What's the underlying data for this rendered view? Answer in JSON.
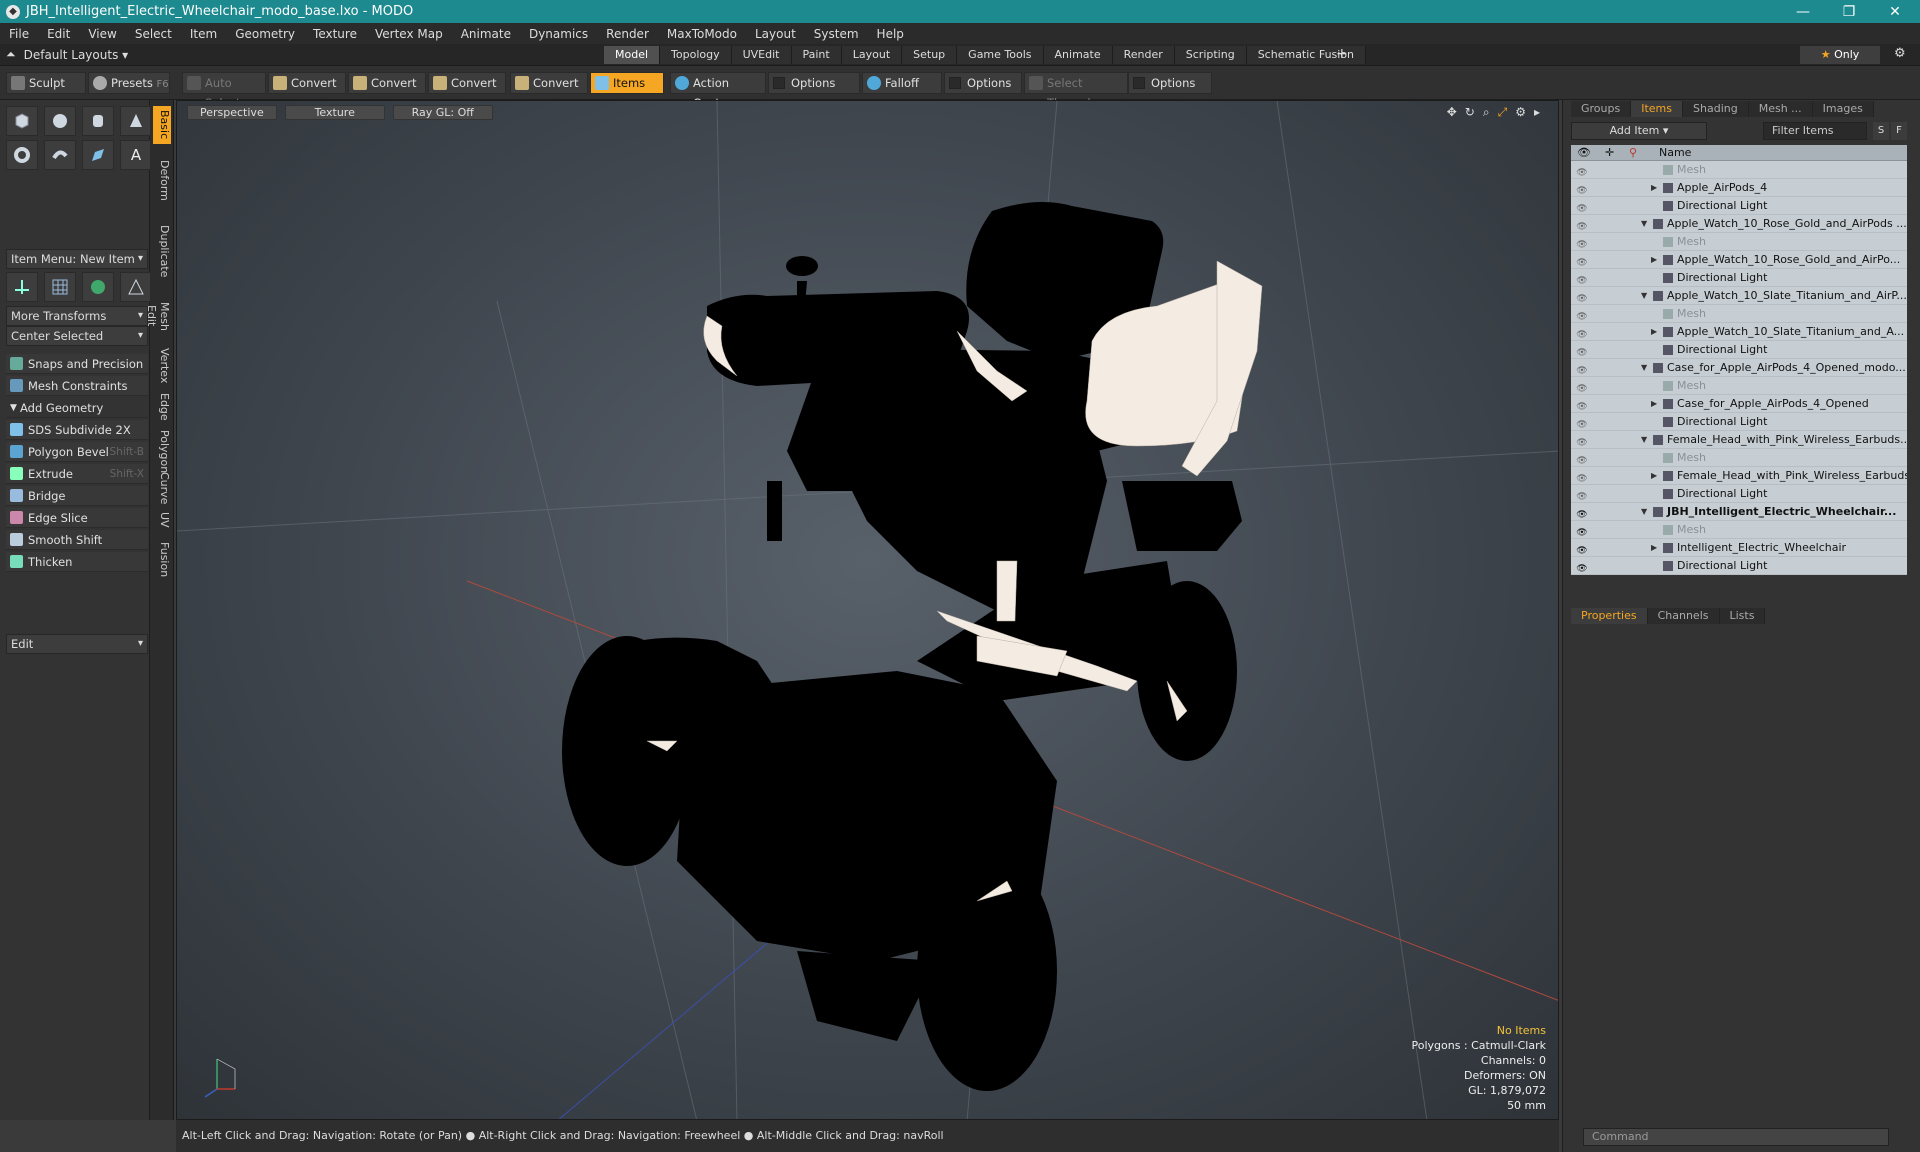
{
  "title": "JBH_Intelligent_Electric_Wheelchair_modo_base.lxo - MODO",
  "menu": [
    "File",
    "Edit",
    "View",
    "Select",
    "Item",
    "Geometry",
    "Texture",
    "Vertex Map",
    "Animate",
    "Dynamics",
    "Render",
    "MaxToModo",
    "Layout",
    "System",
    "Help"
  ],
  "layout_name": "Default Layouts",
  "tabs": [
    "Model",
    "Topology",
    "UVEdit",
    "Paint",
    "Layout",
    "Setup",
    "Game Tools",
    "Animate",
    "Render",
    "Scripting",
    "Schematic Fusion"
  ],
  "only_label": "Only",
  "toolbar": {
    "sculpt": "Sculpt",
    "presets": "Presets",
    "presets_key": "F6",
    "auto_select": "Auto Select",
    "convert": "Convert",
    "items": "Items",
    "action_center": "Action Center",
    "options": "Options",
    "falloff": "Falloff",
    "select_through": "Select Through"
  },
  "left": {
    "item_menu": "Item Menu: New Item",
    "more_transforms": "More Transforms",
    "center_selected": "Center Selected",
    "snaps": "Snaps and Precision",
    "mesh_constraints": "Mesh Constraints",
    "add_geometry": "Add Geometry",
    "tools": [
      {
        "label": "SDS Subdivide 2X",
        "key": ""
      },
      {
        "label": "Polygon Bevel",
        "key": "Shift-B"
      },
      {
        "label": "Extrude",
        "key": "Shift-X"
      },
      {
        "label": "Bridge",
        "key": ""
      },
      {
        "label": "Edge Slice",
        "key": ""
      },
      {
        "label": "Smooth Shift",
        "key": ""
      },
      {
        "label": "Thicken",
        "key": ""
      }
    ],
    "edit": "Edit"
  },
  "vtabs": [
    "Basic",
    "Deform",
    "Duplicate",
    "Mesh Edit",
    "Vertex",
    "Edge",
    "Polygon",
    "Curve",
    "UV",
    "Fusion"
  ],
  "viewport": {
    "perspective": "Perspective",
    "texture": "Texture",
    "raygl": "Ray GL: Off",
    "stats": {
      "no_items": "No Items",
      "polygons": "Polygons : Catmull-Clark",
      "channels": "Channels: 0",
      "deformers": "Deformers: ON",
      "gl": "GL: 1,879,072",
      "lens": "50 mm"
    }
  },
  "right": {
    "tabs": [
      "Groups",
      "Items",
      "Shading",
      "Mesh ...",
      "Images"
    ],
    "add_item": "Add Item",
    "filter": "Filter Items",
    "btn_s": "S",
    "btn_f": "F",
    "name_header": "Name",
    "rows": [
      {
        "label": "Mesh",
        "indent": 2,
        "type": "grey",
        "tri": "",
        "eye": false
      },
      {
        "label": "Apple_AirPods_4",
        "indent": 2,
        "type": "",
        "tri": "▶",
        "eye": false
      },
      {
        "label": "Directional Light",
        "indent": 2,
        "type": "",
        "tri": "",
        "eye": false
      },
      {
        "label": "Apple_Watch_10_Rose_Gold_and_AirPods ...",
        "indent": 1,
        "type": "",
        "tri": "▼",
        "eye": false
      },
      {
        "label": "Mesh",
        "indent": 2,
        "type": "grey",
        "tri": "",
        "eye": false
      },
      {
        "label": "Apple_Watch_10_Rose_Gold_and_AirPo...",
        "indent": 2,
        "type": "",
        "tri": "▶",
        "eye": false
      },
      {
        "label": "Directional Light",
        "indent": 2,
        "type": "",
        "tri": "",
        "eye": false
      },
      {
        "label": "Apple_Watch_10_Slate_Titanium_and_AirP...",
        "indent": 1,
        "type": "",
        "tri": "▼",
        "eye": false
      },
      {
        "label": "Mesh",
        "indent": 2,
        "type": "grey",
        "tri": "",
        "eye": false
      },
      {
        "label": "Apple_Watch_10_Slate_Titanium_and_A...",
        "indent": 2,
        "type": "",
        "tri": "▶",
        "eye": false
      },
      {
        "label": "Directional Light",
        "indent": 2,
        "type": "",
        "tri": "",
        "eye": false
      },
      {
        "label": "Case_for_Apple_AirPods_4_Opened_modo...",
        "indent": 1,
        "type": "",
        "tri": "▼",
        "eye": false
      },
      {
        "label": "Mesh",
        "indent": 2,
        "type": "grey",
        "tri": "",
        "eye": false
      },
      {
        "label": "Case_for_Apple_AirPods_4_Opened",
        "indent": 2,
        "type": "",
        "tri": "▶",
        "eye": false
      },
      {
        "label": "Directional Light",
        "indent": 2,
        "type": "",
        "tri": "",
        "eye": false
      },
      {
        "label": "Female_Head_with_Pink_Wireless_Earbuds...",
        "indent": 1,
        "type": "",
        "tri": "▼",
        "eye": false
      },
      {
        "label": "Mesh",
        "indent": 2,
        "type": "grey",
        "tri": "",
        "eye": false
      },
      {
        "label": "Female_Head_with_Pink_Wireless_Earbuds",
        "indent": 2,
        "type": "",
        "tri": "▶",
        "eye": false
      },
      {
        "label": "Directional Light",
        "indent": 2,
        "type": "",
        "tri": "",
        "eye": false
      },
      {
        "label": "JBH_Intelligent_Electric_Wheelchair...",
        "indent": 1,
        "type": "bold",
        "tri": "▼",
        "eye": true
      },
      {
        "label": "Mesh",
        "indent": 2,
        "type": "grey",
        "tri": "",
        "eye": true
      },
      {
        "label": "Intelligent_Electric_Wheelchair",
        "indent": 2,
        "type": "",
        "tri": "▶",
        "eye": true
      },
      {
        "label": "Directional Light",
        "indent": 2,
        "type": "",
        "tri": "",
        "eye": true
      }
    ],
    "prop_tabs": [
      "Properties",
      "Channels",
      "Lists"
    ],
    "command": "Command"
  },
  "status": "Alt-Left Click and Drag: Navigation: Rotate (or Pan) ● Alt-Right Click and Drag: Navigation: Freewheel ● Alt-Middle Click and Drag: navRoll"
}
